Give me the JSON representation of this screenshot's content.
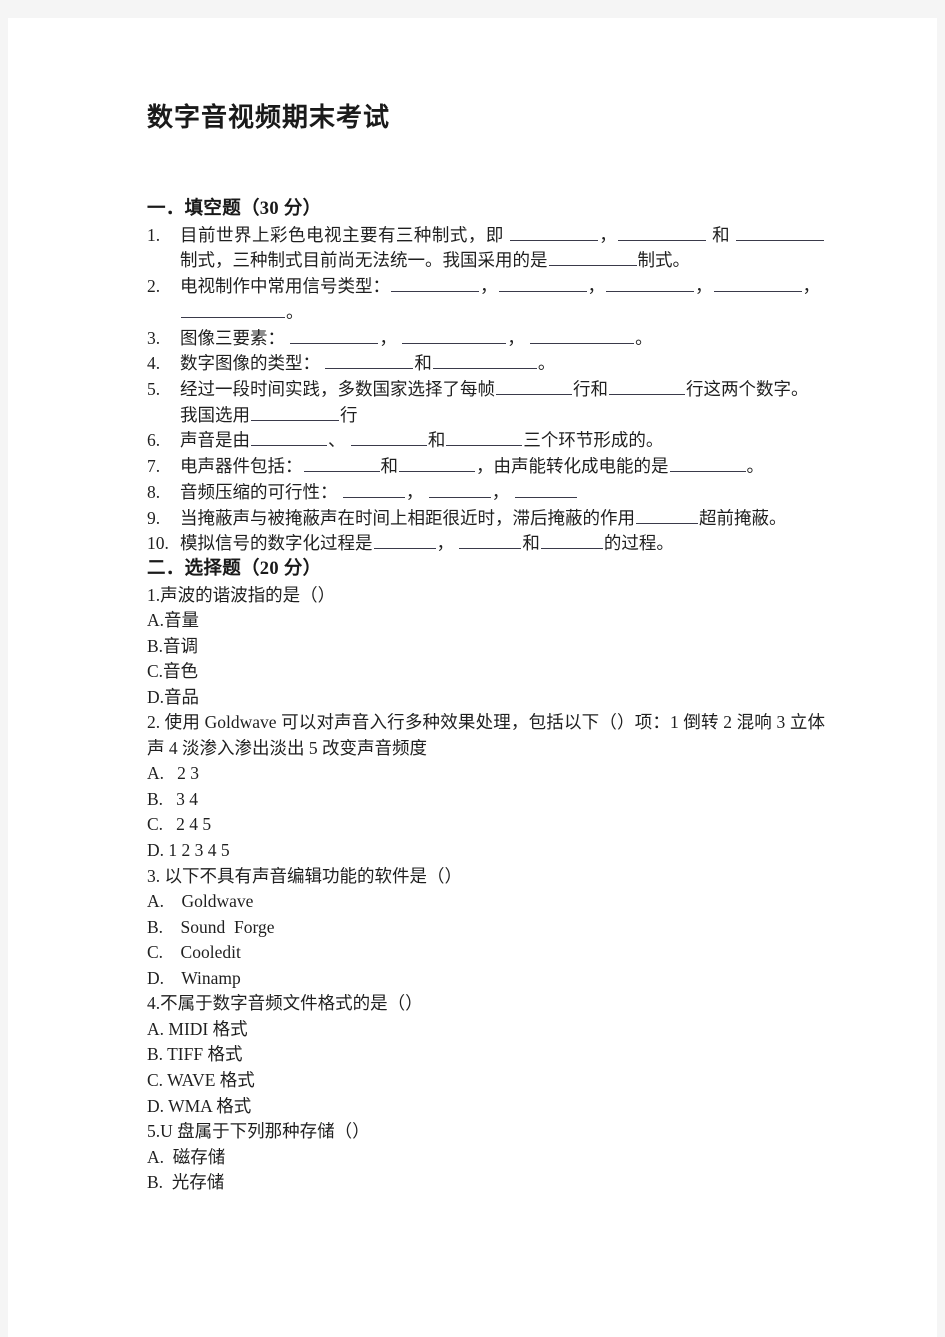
{
  "document": {
    "title": "数字音视频期末考试"
  },
  "sections": [
    {
      "heading": "一．填空题（30 分）",
      "type": "fill-in-blank",
      "questions": [
        {
          "num": "1.",
          "parts": [
            {
              "t": "text",
              "v": "目前世界上彩色电视主要有三种制式，即 "
            },
            {
              "t": "blank",
              "size": "lg"
            },
            {
              "t": "text",
              "v": "，"
            },
            {
              "t": "blank",
              "size": "lg"
            },
            {
              "t": "text",
              "v": " 和 "
            },
            {
              "t": "blank",
              "size": "lg"
            },
            {
              "t": "text",
              "v": "制式，三种制式目前尚无法统一。我国采用的是"
            },
            {
              "t": "blank",
              "size": "lg"
            },
            {
              "t": "text",
              "v": "制式。"
            }
          ]
        },
        {
          "num": "2.",
          "parts": [
            {
              "t": "text",
              "v": "电视制作中常用信号类型："
            },
            {
              "t": "blank",
              "size": "lg"
            },
            {
              "t": "text",
              "v": "，"
            },
            {
              "t": "blank",
              "size": "lg"
            },
            {
              "t": "text",
              "v": "，"
            },
            {
              "t": "blank",
              "size": "lg"
            },
            {
              "t": "text",
              "v": "，"
            },
            {
              "t": "blank",
              "size": "lg"
            },
            {
              "t": "text",
              "v": "，"
            },
            {
              "t": "blank",
              "size": "xl"
            },
            {
              "t": "text",
              "v": "。"
            }
          ]
        },
        {
          "num": "3.",
          "parts": [
            {
              "t": "text",
              "v": "图像三要素： "
            },
            {
              "t": "blank",
              "size": "lg"
            },
            {
              "t": "text",
              "v": "， "
            },
            {
              "t": "blank",
              "size": "xl"
            },
            {
              "t": "text",
              "v": "， "
            },
            {
              "t": "blank",
              "size": "xl"
            },
            {
              "t": "text",
              "v": "。"
            }
          ]
        },
        {
          "num": "4.",
          "parts": [
            {
              "t": "text",
              "v": "数字图像的类型： "
            },
            {
              "t": "blank",
              "size": "lg"
            },
            {
              "t": "text",
              "v": "和"
            },
            {
              "t": "blank",
              "size": "xl"
            },
            {
              "t": "text",
              "v": "。"
            }
          ]
        },
        {
          "num": "5.",
          "parts": [
            {
              "t": "text",
              "v": "经过一段时间实践，多数国家选择了每帧"
            },
            {
              "t": "blank",
              "size": "md"
            },
            {
              "t": "text",
              "v": "行和"
            },
            {
              "t": "blank",
              "size": "md"
            },
            {
              "t": "text",
              "v": "行这两个数字。我国选用"
            },
            {
              "t": "blank",
              "size": "lg"
            },
            {
              "t": "text",
              "v": "行"
            }
          ]
        },
        {
          "num": "6.",
          "parts": [
            {
              "t": "text",
              "v": "声音是由"
            },
            {
              "t": "blank",
              "size": "md"
            },
            {
              "t": "text",
              "v": "、 "
            },
            {
              "t": "blank",
              "size": "md"
            },
            {
              "t": "text",
              "v": "和"
            },
            {
              "t": "blank",
              "size": "md"
            },
            {
              "t": "text",
              "v": "三个环节形成的。"
            }
          ]
        },
        {
          "num": "7.",
          "parts": [
            {
              "t": "text",
              "v": "电声器件包括："
            },
            {
              "t": "blank",
              "size": "md"
            },
            {
              "t": "text",
              "v": "和"
            },
            {
              "t": "blank",
              "size": "md"
            },
            {
              "t": "text",
              "v": "，由声能转化成电能的是"
            },
            {
              "t": "blank",
              "size": "md"
            },
            {
              "t": "text",
              "v": "。"
            }
          ]
        },
        {
          "num": "8.",
          "parts": [
            {
              "t": "text",
              "v": "音频压缩的可行性： "
            },
            {
              "t": "blank",
              "size": "sm"
            },
            {
              "t": "text",
              "v": "， "
            },
            {
              "t": "blank",
              "size": "sm"
            },
            {
              "t": "text",
              "v": "， "
            },
            {
              "t": "blank",
              "size": "sm"
            }
          ]
        },
        {
          "num": "9.",
          "parts": [
            {
              "t": "text",
              "v": "当掩蔽声与被掩蔽声在时间上相距很近时，滞后掩蔽的作用"
            },
            {
              "t": "blank",
              "size": "sm"
            },
            {
              "t": "text",
              "v": "超前掩蔽。"
            }
          ]
        },
        {
          "num": "10.",
          "parts": [
            {
              "t": "text",
              "v": "模拟信号的数字化过程是"
            },
            {
              "t": "blank",
              "size": "sm"
            },
            {
              "t": "text",
              "v": "， "
            },
            {
              "t": "blank",
              "size": "sm"
            },
            {
              "t": "text",
              "v": "和"
            },
            {
              "t": "blank",
              "size": "sm"
            },
            {
              "t": "text",
              "v": "的过程。"
            }
          ]
        }
      ]
    },
    {
      "heading": "二．选择题（20 分）",
      "type": "multiple-choice",
      "questions": [
        {
          "stem": "1.声波的谐波指的是（）",
          "options": [
            "A.音量",
            "B.音调",
            "C.音色",
            "D.音品"
          ]
        },
        {
          "stem": "2. 使用 Goldwave 可以对声音入行多种效果处理，包括以下（）项：1 倒转 2 混响 3 立体声 4 淡渗入渗出淡出 5 改变声音频度",
          "options": [
            "A.   2 3",
            "B.   3 4",
            "C.   2 4 5",
            "D. 1 2 3 4 5"
          ]
        },
        {
          "stem": "3. 以下不具有声音编辑功能的软件是（）",
          "options": [
            "A.    Goldwave",
            "B.    Sound  Forge",
            "C.    Cooledit",
            "D.    Winamp"
          ]
        },
        {
          "stem": "4.不属于数字音频文件格式的是（）",
          "options": [
            "A. MIDI 格式",
            "B. TIFF 格式",
            "C. WAVE 格式",
            "D. WMA 格式"
          ]
        },
        {
          "stem": "5.U 盘属于下列那种存储（）",
          "options": [
            "A.  磁存储",
            "B.  光存储"
          ]
        }
      ]
    }
  ]
}
